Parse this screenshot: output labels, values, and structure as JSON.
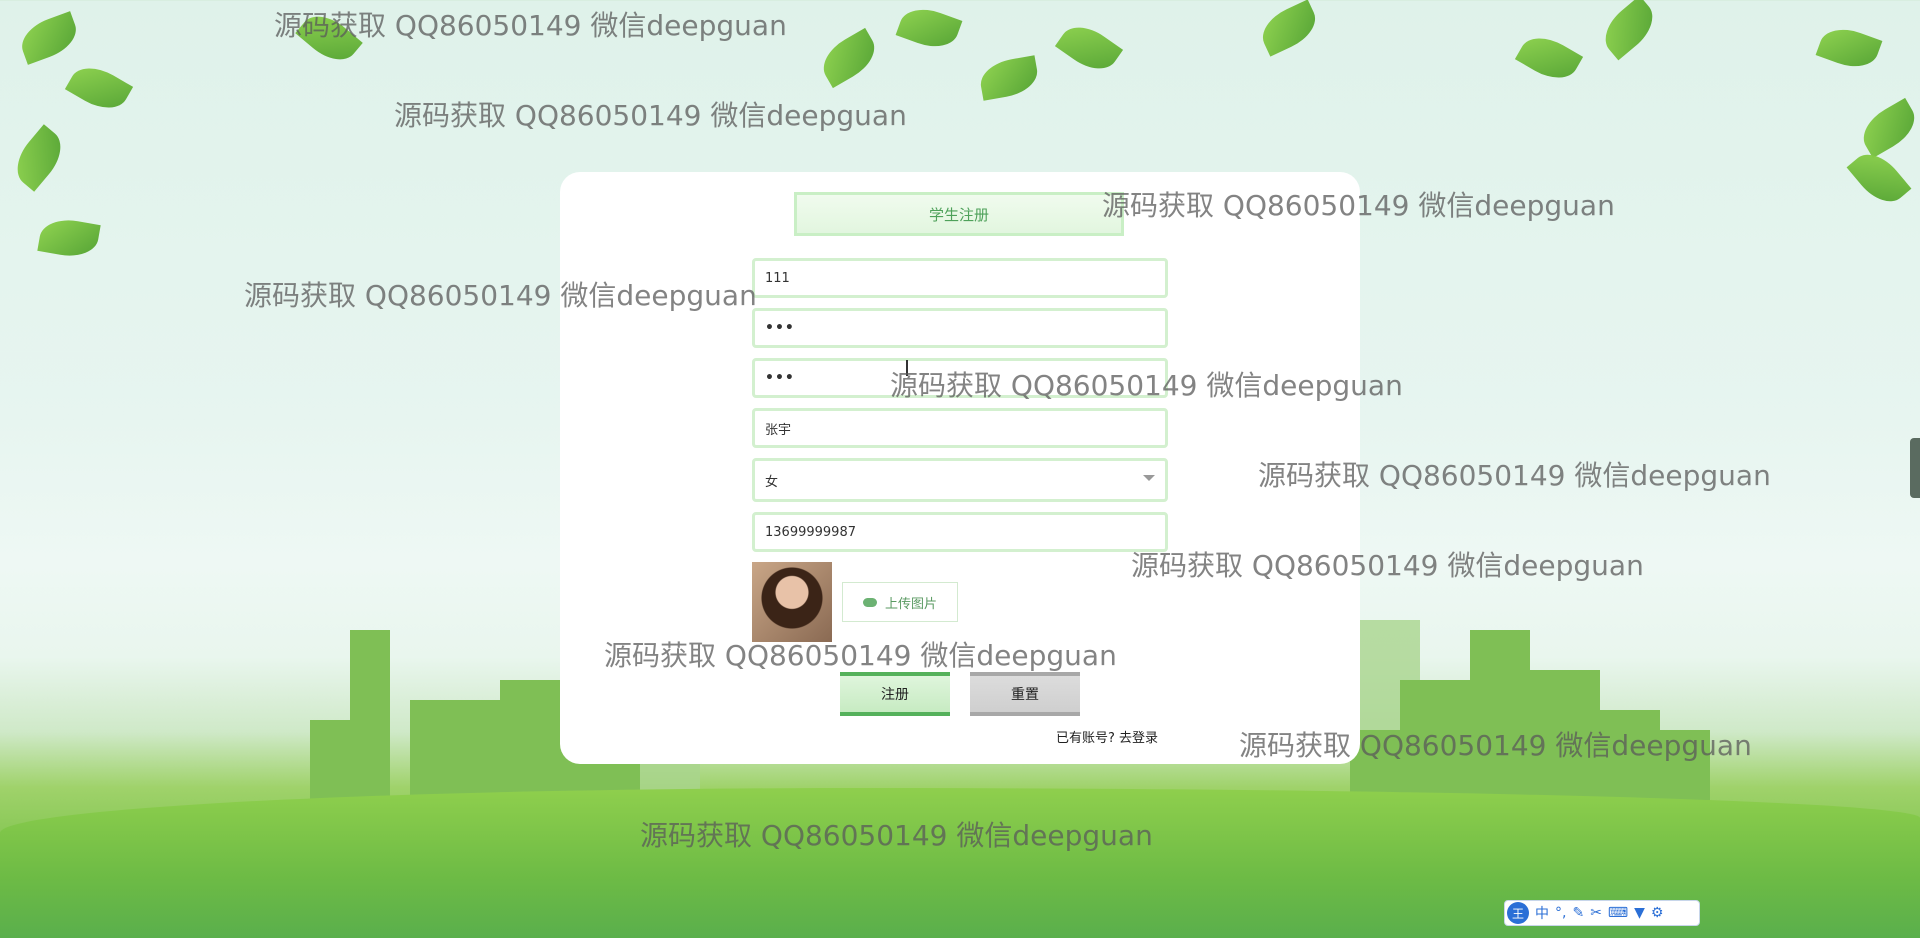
{
  "form": {
    "title": "学生注册",
    "account_value": "111",
    "password_value": "•••",
    "confirm_password_value": "•••",
    "name_value": "张宇",
    "gender_value": "女",
    "phone_value": "13699999987",
    "upload_label": "上传图片",
    "register_label": "注册",
    "reset_label": "重置",
    "login_prompt": "已有账号?",
    "login_link": "去登录"
  },
  "watermark": "源码获取 QQ86050149 微信deepguan",
  "ime": {
    "logo": "王",
    "mode": "中",
    "punct": "°,"
  },
  "colors": {
    "accent": "#55b15b",
    "card": "#ffffff"
  },
  "icons": [
    "upload-cloud-icon",
    "chevron-down-icon",
    "pen-icon",
    "scissors-icon",
    "keyboard-icon",
    "shirt-icon",
    "gear-icon"
  ]
}
